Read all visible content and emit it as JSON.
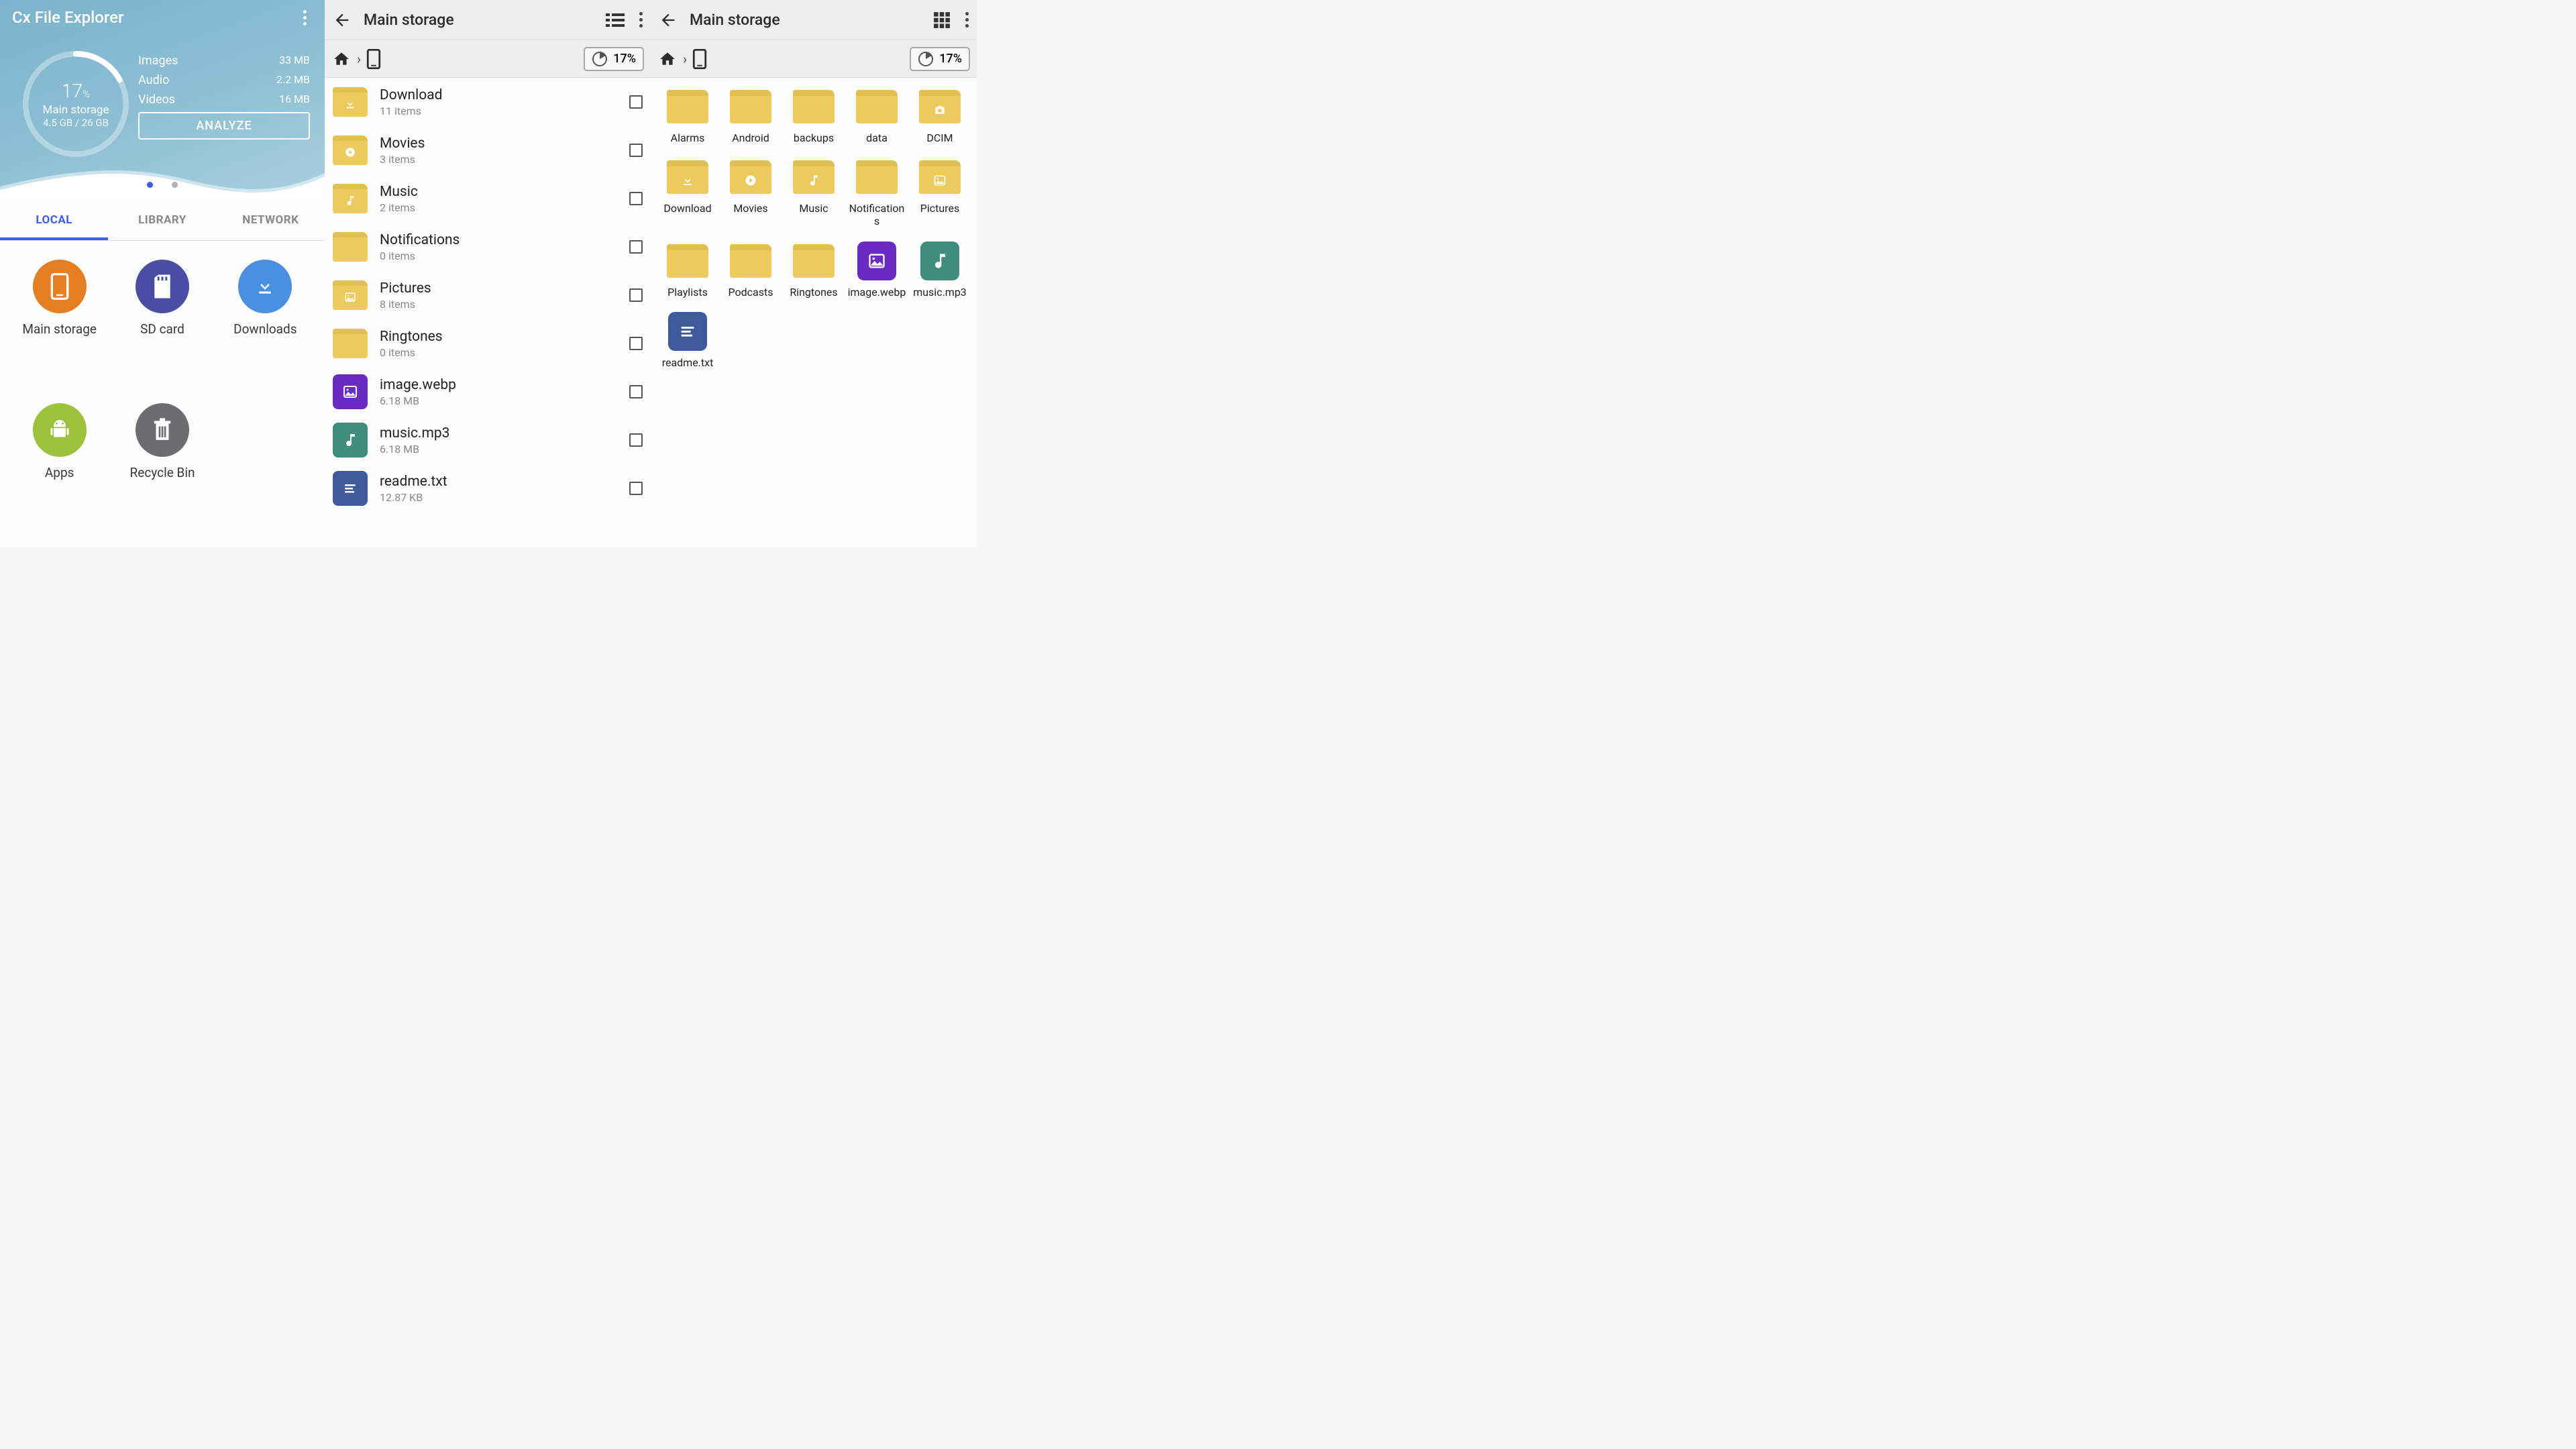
{
  "pane1": {
    "app_title": "Cx File Explorer",
    "ring": {
      "pct_num": "17",
      "pct_sym": "%",
      "label": "Main storage",
      "size": "4.5 GB / 26 GB"
    },
    "media": [
      {
        "label": "Images",
        "val": "33 MB"
      },
      {
        "label": "Audio",
        "val": "2.2 MB"
      },
      {
        "label": "Videos",
        "val": "16 MB"
      }
    ],
    "analyze": "ANALYZE",
    "tabs": {
      "local": "LOCAL",
      "library": "LIBRARY",
      "network": "NETWORK"
    },
    "grid": [
      {
        "label": "Main storage",
        "color": "#e67e22",
        "icon": "device"
      },
      {
        "label": "SD card",
        "color": "#4a4ea3",
        "icon": "sd"
      },
      {
        "label": "Downloads",
        "color": "#4a90e2",
        "icon": "download"
      },
      {
        "label": "Apps",
        "color": "#9cc23c",
        "icon": "android"
      },
      {
        "label": "Recycle Bin",
        "color": "#6b6e70",
        "icon": "trash"
      }
    ]
  },
  "pane2": {
    "title": "Main storage",
    "pct": "17%",
    "items": [
      {
        "name": "Download",
        "sub": "11 items",
        "type": "folder",
        "glyph": "download"
      },
      {
        "name": "Movies",
        "sub": "3 items",
        "type": "folder",
        "glyph": "play"
      },
      {
        "name": "Music",
        "sub": "2 items",
        "type": "folder",
        "glyph": "music"
      },
      {
        "name": "Notifications",
        "sub": "0 items",
        "type": "folder",
        "glyph": ""
      },
      {
        "name": "Pictures",
        "sub": "8 items",
        "type": "folder",
        "glyph": "image"
      },
      {
        "name": "Ringtones",
        "sub": "0 items",
        "type": "folder",
        "glyph": ""
      },
      {
        "name": "image.webp",
        "sub": "6.18 MB",
        "type": "file",
        "color": "#6a2cc0",
        "glyph": "image"
      },
      {
        "name": "music.mp3",
        "sub": "6.18 MB",
        "type": "file",
        "color": "#3e8d7f",
        "glyph": "music"
      },
      {
        "name": "readme.txt",
        "sub": "12.87 KB",
        "type": "file",
        "color": "#3d5a9a",
        "glyph": "text"
      }
    ]
  },
  "pane3": {
    "title": "Main storage",
    "pct": "17%",
    "items": [
      {
        "name": "Alarms",
        "type": "folder",
        "glyph": ""
      },
      {
        "name": "Android",
        "type": "folder",
        "glyph": ""
      },
      {
        "name": "backups",
        "type": "folder",
        "glyph": ""
      },
      {
        "name": "data",
        "type": "folder",
        "glyph": ""
      },
      {
        "name": "DCIM",
        "type": "folder",
        "glyph": "camera"
      },
      {
        "name": "Download",
        "type": "folder",
        "glyph": "download"
      },
      {
        "name": "Movies",
        "type": "folder",
        "glyph": "play"
      },
      {
        "name": "Music",
        "type": "folder",
        "glyph": "music"
      },
      {
        "name": "Notifications",
        "type": "folder",
        "glyph": ""
      },
      {
        "name": "Pictures",
        "type": "folder",
        "glyph": "image"
      },
      {
        "name": "Playlists",
        "type": "folder",
        "glyph": ""
      },
      {
        "name": "Podcasts",
        "type": "folder",
        "glyph": ""
      },
      {
        "name": "Ringtones",
        "type": "folder",
        "glyph": ""
      },
      {
        "name": "image.webp",
        "type": "file",
        "color": "#6a2cc0",
        "glyph": "image"
      },
      {
        "name": "music.mp3",
        "type": "file",
        "color": "#3e8d7f",
        "glyph": "music"
      },
      {
        "name": "readme.txt",
        "type": "file",
        "color": "#3d5a9a",
        "glyph": "text"
      }
    ]
  }
}
